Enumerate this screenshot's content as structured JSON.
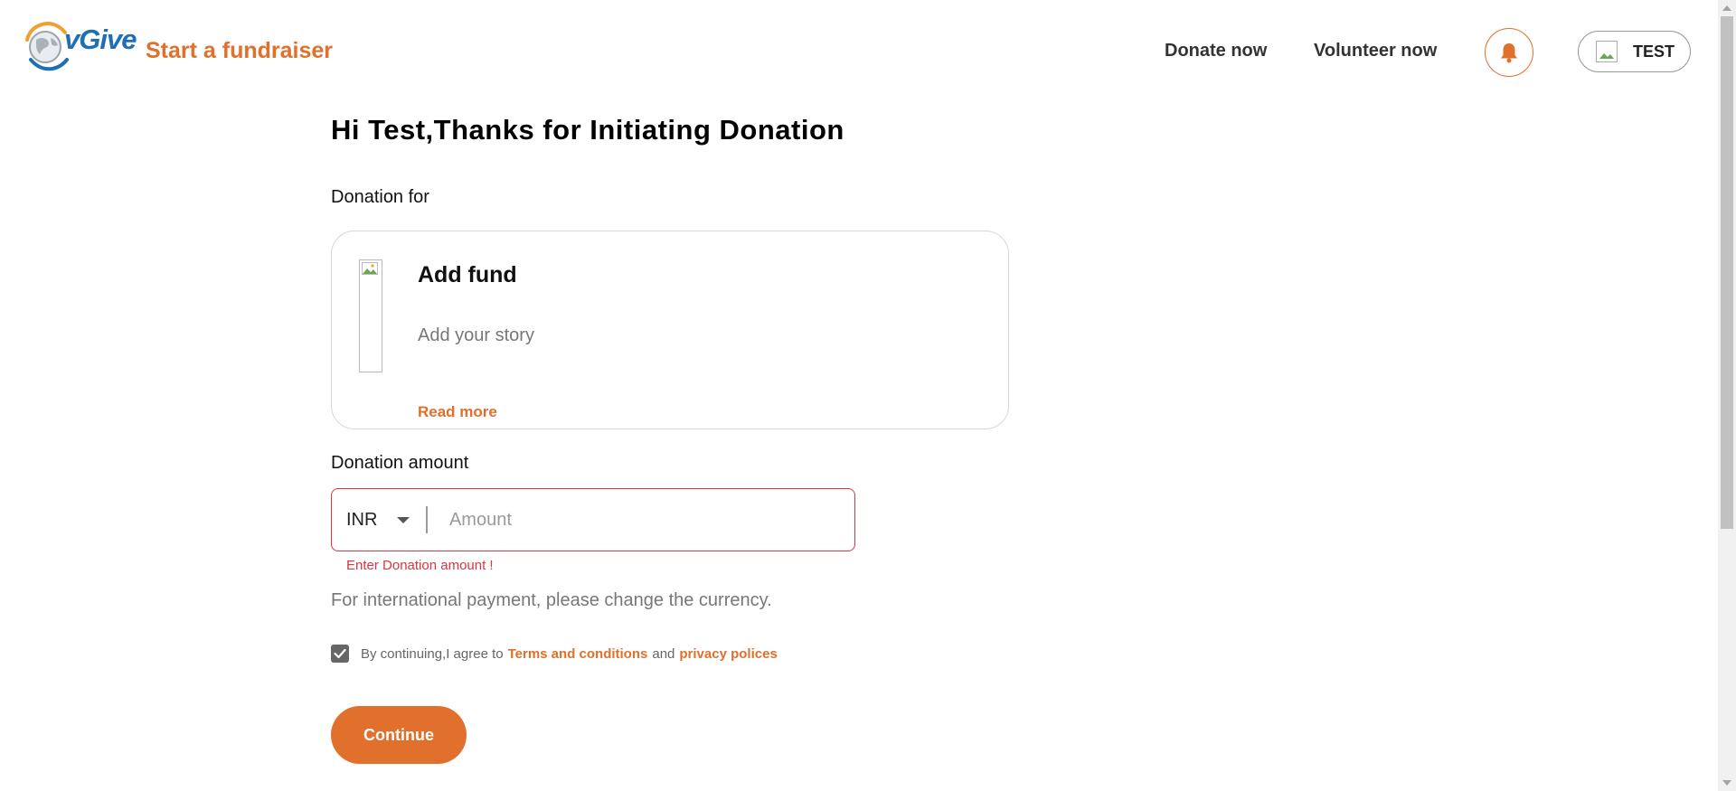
{
  "header": {
    "logo_text": "vGive",
    "start_fundraiser": "Start a fundraiser",
    "nav": {
      "donate_now": "Donate now",
      "volunteer_now": "Volunteer now"
    },
    "user_name": "TEST",
    "icons": [
      "globe-logo-icon",
      "bell-icon",
      "user-avatar-icon"
    ]
  },
  "main": {
    "greeting": "Hi Test,Thanks for Initiating Donation",
    "donation_for_label": "Donation for",
    "fund_card": {
      "title": "Add fund",
      "story": "Add your story",
      "read_more": "Read more"
    },
    "donation_amount_label": "Donation amount",
    "amount": {
      "currency": "INR",
      "placeholder": "Amount",
      "value": "",
      "error": "Enter Donation amount !"
    },
    "intl_note": "For international payment, please change the currency.",
    "agreement": {
      "checked": true,
      "prefix": "By continuing,I agree to",
      "terms_link": "Terms and conditions",
      "and": "and",
      "privacy_link": "privacy polices"
    },
    "continue_label": "Continue"
  },
  "colors": {
    "accent": "#e0702b",
    "error": "#d9363e",
    "brand_blue": "#1e6fb5"
  }
}
